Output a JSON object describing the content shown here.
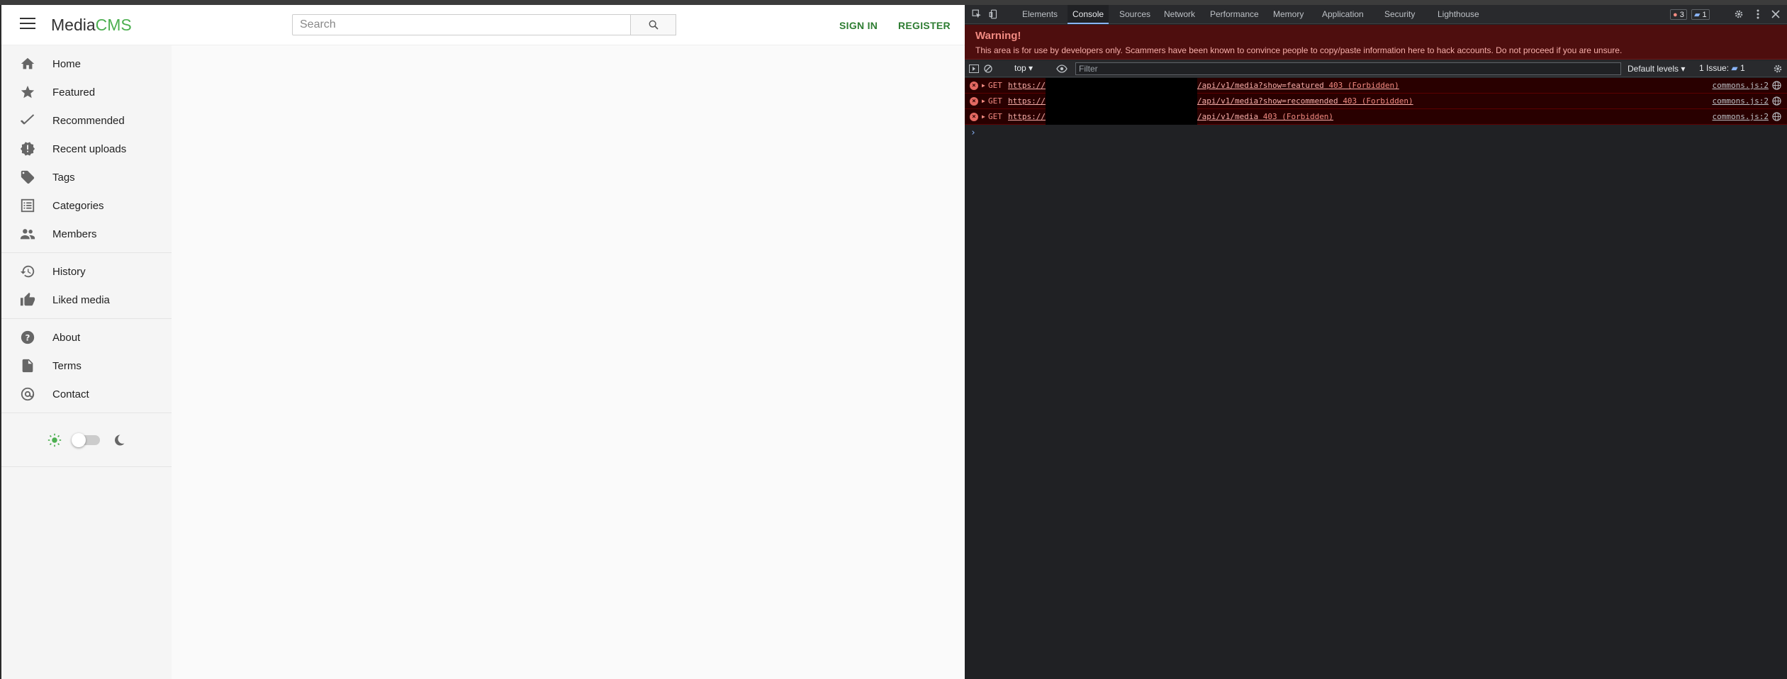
{
  "app": {
    "logo_left": "Media",
    "logo_right": "CMS",
    "search": {
      "placeholder": "Search",
      "value": ""
    },
    "sign_in": "SIGN IN",
    "register": "REGISTER",
    "sidebar": {
      "groups": [
        [
          {
            "label": "Home",
            "icon": "home-icon"
          },
          {
            "label": "Featured",
            "icon": "star-icon"
          },
          {
            "label": "Recommended",
            "icon": "check-double-icon"
          },
          {
            "label": "Recent uploads",
            "icon": "new-releases-icon"
          },
          {
            "label": "Tags",
            "icon": "tag-icon"
          },
          {
            "label": "Categories",
            "icon": "list-icon"
          },
          {
            "label": "Members",
            "icon": "people-icon"
          }
        ],
        [
          {
            "label": "History",
            "icon": "history-icon"
          },
          {
            "label": "Liked media",
            "icon": "thumb-up-icon"
          }
        ],
        [
          {
            "label": "About",
            "icon": "help-icon"
          },
          {
            "label": "Terms",
            "icon": "document-icon"
          },
          {
            "label": "Contact",
            "icon": "at-sign-icon"
          }
        ]
      ],
      "theme_toggle": {
        "light_icon": "sun-icon",
        "dark_icon": "moon-icon",
        "dark_enabled": false
      }
    },
    "colors": {
      "accent": "#4caf50",
      "link": "#2e7d32"
    }
  },
  "devtools": {
    "tabs": [
      "Elements",
      "Console",
      "Sources",
      "Network",
      "Performance",
      "Memory",
      "Application",
      "Security",
      "Lighthouse"
    ],
    "active_tab": "Console",
    "error_badge": "3",
    "issue_badge": "1",
    "warning": {
      "title": "Warning!",
      "body": "This area is for use by developers only. Scammers have been known to convince people to copy/paste information here to hack accounts. Do not proceed if you are unsure."
    },
    "toolbar": {
      "context": "top",
      "filter_placeholder": "Filter",
      "levels": "Default levels",
      "issues_label": "1 Issue:",
      "issues_count": "1"
    },
    "logs": [
      {
        "method": "GET",
        "url_prefix": "https://",
        "url_suffix": "/api/v1/media?show=featured",
        "status": "403 (Forbidden)",
        "source": "commons.js:2"
      },
      {
        "method": "GET",
        "url_prefix": "https://",
        "url_suffix": "/api/v1/media?show=recommended",
        "status": "403 (Forbidden)",
        "source": "commons.js:2"
      },
      {
        "method": "GET",
        "url_prefix": "https://",
        "url_suffix": "/api/v1/media",
        "status": "403 (Forbidden)",
        "source": "commons.js:2"
      }
    ],
    "prompt_symbol": "›",
    "colors": {
      "error_bg": "#290000",
      "error_text": "#f28b82",
      "warning_bg": "#4e0e0e"
    }
  }
}
